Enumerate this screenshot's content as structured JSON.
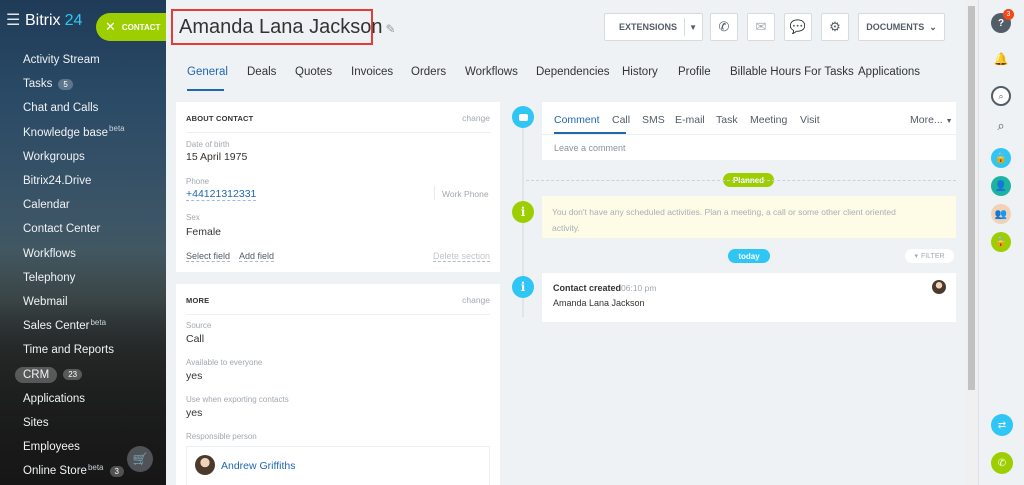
{
  "sidebar": {
    "logo": {
      "text": "Bitrix",
      "number": "24"
    },
    "contact_button": "CONTACT",
    "items": [
      {
        "label": "Activity Stream"
      },
      {
        "label": "Tasks",
        "badge": "5"
      },
      {
        "label": "Chat and Calls"
      },
      {
        "label": "Knowledge base",
        "sup": "beta"
      },
      {
        "label": "Workgroups"
      },
      {
        "label": "Bitrix24.Drive"
      },
      {
        "label": "Calendar"
      },
      {
        "label": "Contact Center"
      },
      {
        "label": "Workflows"
      },
      {
        "label": "Telephony"
      },
      {
        "label": "Webmail"
      },
      {
        "label": "Sales Center",
        "sup": "beta"
      },
      {
        "label": "Time and Reports"
      },
      {
        "label": "CRM",
        "badge": "23"
      },
      {
        "label": "Applications"
      },
      {
        "label": "Sites"
      },
      {
        "label": "Employees"
      },
      {
        "label": "Online Store",
        "sup": "beta",
        "badge": "3"
      }
    ]
  },
  "header": {
    "title": "Amanda Lana  Jackson",
    "extensions_label": "EXTENSIONS",
    "documents_label": "DOCUMENTS"
  },
  "tabs": [
    {
      "label": "General",
      "active": true
    },
    {
      "label": "Deals"
    },
    {
      "label": "Quotes"
    },
    {
      "label": "Invoices"
    },
    {
      "label": "Orders"
    },
    {
      "label": "Workflows"
    },
    {
      "label": "Dependencies"
    },
    {
      "label": "History"
    },
    {
      "label": "Profile"
    },
    {
      "label": "Billable Hours For Tasks"
    },
    {
      "label": "Applications"
    }
  ],
  "about": {
    "heading": "ABOUT CONTACT",
    "change": "change",
    "dob_label": "Date of birth",
    "dob_value": "15 April 1975",
    "phone_label": "Phone",
    "phone_value": "+44121312331",
    "phone_type": "Work Phone",
    "sex_label": "Sex",
    "sex_value": "Female",
    "select_field": "Select field",
    "add_field": "Add field",
    "delete_section": "Delete section"
  },
  "more": {
    "heading": "MORE",
    "change": "change",
    "source_label": "Source",
    "source_value": "Call",
    "available_label": "Available to everyone",
    "available_value": "yes",
    "export_label": "Use when exporting contacts",
    "export_value": "yes",
    "responsible_label": "Responsible person",
    "responsible_name": "Andrew Griffiths"
  },
  "activity": {
    "tabs": [
      "Comment",
      "Call",
      "SMS",
      "E-mail",
      "Task",
      "Meeting",
      "Visit"
    ],
    "more": "More...",
    "placeholder": "Leave a comment",
    "planned": "Planned",
    "planned_text": "You don't have any scheduled activities. Plan a meeting, a call or some other client oriented activity.",
    "today": "today",
    "filter": "FILTER",
    "event_title": "Contact created",
    "event_time": "06:10 pm",
    "event_body": "Amanda Lana Jackson"
  },
  "rightbar": {
    "notification_count": "3"
  },
  "colors": {
    "accent_green": "#9dcf00",
    "link_blue": "#2067b0",
    "timeline_blue": "#2fc6f6",
    "title_highlight": "#e53b3b"
  }
}
